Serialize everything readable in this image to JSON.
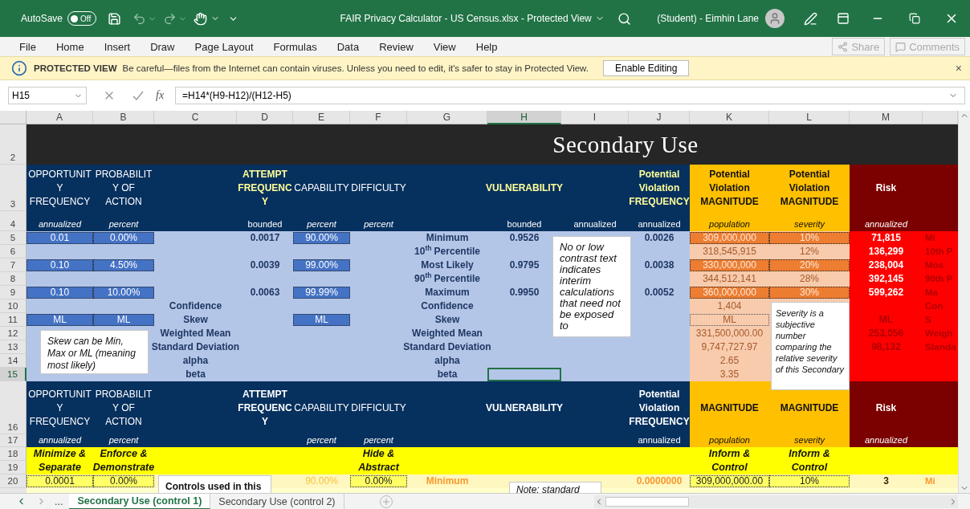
{
  "title_bar": {
    "autosave": {
      "label": "AutoSave",
      "on": false,
      "state_text": "Off"
    },
    "title": "FAIR Privacy Calculator - US Census.xlsx  -  Protected View",
    "user": "(Student) - Eimhin Lane"
  },
  "menu": {
    "items": [
      "File",
      "Home",
      "Insert",
      "Draw",
      "Page Layout",
      "Formulas",
      "Data",
      "Review",
      "View",
      "Help"
    ],
    "actions": [
      {
        "label": "Share",
        "kind": "share",
        "disabled": true
      },
      {
        "label": "Comments",
        "kind": "comments",
        "disabled": true
      }
    ]
  },
  "protected_view": {
    "title": "PROTECTED VIEW",
    "message": "Be careful—files from the Internet can contain viruses. Unless you need to edit, it's safer to stay in Protected View.",
    "button": "Enable Editing",
    "close": "×"
  },
  "formula_bar": {
    "name_box": "H15",
    "function_label": "fx",
    "formula": "=H14*(H9-H12)/(H12-H5)"
  },
  "columns": [
    {
      "label": "A",
      "selected": false
    },
    {
      "label": "B",
      "selected": false
    },
    {
      "label": "C",
      "selected": false
    },
    {
      "label": "D",
      "selected": false
    },
    {
      "label": "E",
      "selected": false
    },
    {
      "label": "F",
      "selected": false
    },
    {
      "label": "G",
      "selected": false
    },
    {
      "label": "H",
      "selected": true
    },
    {
      "label": "I",
      "selected": false
    },
    {
      "label": "J",
      "selected": false
    },
    {
      "label": "K",
      "selected": false
    },
    {
      "label": "L",
      "selected": false
    },
    {
      "label": "M",
      "selected": false
    },
    {
      "selected": false
    }
  ],
  "rows": [
    {
      "label": "2",
      "kind": "title",
      "selected": false,
      "cells": [
        null,
        null,
        null,
        null,
        {
          "kind": "title",
          "text": "Secondary Use"
        },
        null,
        null,
        null,
        null,
        null,
        null,
        null,
        null,
        null
      ]
    },
    {
      "label": "3",
      "kind": "header",
      "selected": false,
      "cells": [
        {
          "kind": "heading",
          "text": "OPPORTUNIT\nY\nFREQUENCY"
        },
        {
          "kind": "heading",
          "text": "PROBABILIT\nY OF\nACTION"
        },
        null,
        {
          "kind": "heading-accent",
          "text": "ATTEMPT\nFREQUENC\nY"
        },
        {
          "kind": "heading",
          "text": "CAPABILITY"
        },
        {
          "kind": "heading",
          "text": "DIFFICULTY"
        },
        null,
        {
          "kind": "heading-accent",
          "text": "VULNERABILITY"
        },
        null,
        {
          "kind": "heading-accent",
          "text": "Potential\nViolation\nFREQUENCY"
        },
        {
          "kind": "heading-strong",
          "text": "Potential\nViolation\nMAGNITUDE"
        },
        {
          "kind": "heading-strong",
          "text": "Potential\nViolation\nMAGNITUDE"
        },
        {
          "kind": "heading-strong",
          "text": "Risk"
        },
        null
      ]
    },
    {
      "label": "4",
      "kind": "units",
      "selected": false,
      "cells": [
        {
          "kind": "unit",
          "italic": true,
          "text": "annualized"
        },
        {
          "kind": "unit",
          "italic": true,
          "text": "percent"
        },
        null,
        {
          "kind": "unit",
          "italic": false,
          "text": "bounded"
        },
        {
          "kind": "unit",
          "italic": true,
          "text": "percent"
        },
        {
          "kind": "unit",
          "italic": true,
          "text": "percent"
        },
        null,
        {
          "kind": "unit",
          "italic": false,
          "text": "bounded"
        },
        {
          "kind": "unit",
          "italic": false,
          "text": "annualized"
        },
        {
          "kind": "unit",
          "italic": false,
          "text": "annualized"
        },
        {
          "kind": "unit",
          "italic": true,
          "text": "population"
        },
        {
          "kind": "unit",
          "italic": true,
          "text": "severity"
        },
        {
          "kind": "unit",
          "italic": true,
          "text": "annualized"
        },
        null
      ]
    },
    {
      "label": "5",
      "kind": "body",
      "selected": false,
      "cells": [
        {
          "kind": "input",
          "text": "0.01"
        },
        {
          "kind": "input",
          "text": "0.00%"
        },
        null,
        {
          "kind": "value",
          "text": "0.0017"
        },
        {
          "kind": "input",
          "text": "90.00%"
        },
        null,
        {
          "kind": "value",
          "text": "Minimum"
        },
        {
          "kind": "value",
          "text": "0.9526"
        },
        null,
        {
          "kind": "value",
          "text": "0.0026"
        },
        {
          "kind": "orange-input",
          "text": "309,000,000"
        },
        {
          "kind": "orange-input",
          "text": "10%"
        },
        {
          "kind": "risk",
          "text": "71,815"
        },
        {
          "kind": "edge",
          "text": "Mi"
        }
      ]
    },
    {
      "label": "6",
      "kind": "body",
      "selected": false,
      "cells": [
        null,
        null,
        null,
        null,
        null,
        null,
        {
          "kind": "value",
          "text": "10$^{th}$ Percentile"
        },
        null,
        null,
        null,
        {
          "kind": "faint",
          "text": "318,545,915"
        },
        {
          "kind": "faint",
          "text": "12%"
        },
        {
          "kind": "risk",
          "text": "136,299"
        },
        {
          "kind": "edge",
          "text": "10th P"
        }
      ]
    },
    {
      "label": "7",
      "kind": "body",
      "selected": false,
      "cells": [
        {
          "kind": "input",
          "text": "0.10"
        },
        {
          "kind": "input",
          "text": "4.50%"
        },
        null,
        {
          "kind": "value",
          "text": "0.0039"
        },
        {
          "kind": "input",
          "text": "99.00%"
        },
        null,
        {
          "kind": "value",
          "text": "Most Likely"
        },
        {
          "kind": "value",
          "text": "0.9795"
        },
        null,
        {
          "kind": "value",
          "text": "0.0038"
        },
        {
          "kind": "orange-input",
          "text": "330,000,000"
        },
        {
          "kind": "orange-input",
          "text": "20%"
        },
        {
          "kind": "risk",
          "text": "238,004"
        },
        {
          "kind": "edge",
          "text": "Mos"
        }
      ]
    },
    {
      "label": "8",
      "kind": "body",
      "selected": false,
      "cells": [
        null,
        null,
        null,
        null,
        null,
        null,
        {
          "kind": "value",
          "text": "90$^{th}$ Percentile"
        },
        null,
        null,
        null,
        {
          "kind": "faint",
          "text": "344,512,141"
        },
        {
          "kind": "faint",
          "text": "28%"
        },
        {
          "kind": "risk",
          "text": "392,145"
        },
        {
          "kind": "edge",
          "text": "90th P"
        }
      ]
    },
    {
      "label": "9",
      "kind": "body",
      "selected": false,
      "cells": [
        {
          "kind": "input",
          "text": "0.10"
        },
        {
          "kind": "input",
          "text": "10.00%"
        },
        null,
        {
          "kind": "value",
          "text": "0.0063"
        },
        {
          "kind": "input",
          "text": "99.99%"
        },
        null,
        {
          "kind": "value",
          "text": "Maximum"
        },
        {
          "kind": "value",
          "text": "0.9950"
        },
        null,
        {
          "kind": "value",
          "text": "0.0052"
        },
        {
          "kind": "orange-input",
          "text": "360,000,000"
        },
        {
          "kind": "orange-input",
          "text": "30%"
        },
        {
          "kind": "risk",
          "text": "599,262"
        },
        {
          "kind": "edge",
          "text": "Ma"
        }
      ]
    },
    {
      "label": "10",
      "kind": "body",
      "selected": false,
      "cells": [
        null,
        null,
        {
          "kind": "value",
          "text": "Confidence"
        },
        null,
        null,
        null,
        {
          "kind": "value",
          "text": "Confidence"
        },
        null,
        null,
        null,
        {
          "kind": "faint",
          "text": "1,404"
        },
        null,
        null,
        {
          "kind": "edge",
          "text": "Con"
        }
      ]
    },
    {
      "label": "11",
      "kind": "body",
      "selected": false,
      "cells": [
        {
          "kind": "input",
          "text": "ML"
        },
        {
          "kind": "input",
          "text": "ML"
        },
        {
          "kind": "value",
          "text": "Skew"
        },
        null,
        {
          "kind": "input",
          "text": "ML"
        },
        null,
        {
          "kind": "value",
          "text": "Skew"
        },
        null,
        null,
        null,
        {
          "kind": "faint-input",
          "text": "ML"
        },
        null,
        {
          "kind": "risk-faint",
          "text": "ML"
        },
        {
          "kind": "edge",
          "text": "S"
        }
      ]
    },
    {
      "label": "12",
      "kind": "body",
      "selected": false,
      "cells": [
        null,
        null,
        {
          "kind": "value",
          "text": "Weighted Mean"
        },
        null,
        null,
        null,
        {
          "kind": "value",
          "text": "Weighted Mean"
        },
        null,
        null,
        null,
        {
          "kind": "faint",
          "text": "331,500,000.00"
        },
        null,
        {
          "kind": "risk-faint",
          "text": "253,056"
        },
        {
          "kind": "edge",
          "text": "Weigh"
        }
      ]
    },
    {
      "label": "13",
      "kind": "body",
      "selected": false,
      "cells": [
        null,
        null,
        {
          "kind": "value",
          "text": "Standard Deviation"
        },
        null,
        null,
        null,
        {
          "kind": "value",
          "text": "Standard Deviation"
        },
        null,
        null,
        null,
        {
          "kind": "faint",
          "text": "9,747,727.97"
        },
        null,
        {
          "kind": "risk-faint",
          "text": "98,132"
        },
        {
          "kind": "edge",
          "text": "Standa"
        }
      ]
    },
    {
      "label": "14",
      "kind": "body",
      "selected": false,
      "cells": [
        null,
        null,
        {
          "kind": "value",
          "text": "alpha"
        },
        null,
        null,
        null,
        {
          "kind": "value",
          "text": "alpha"
        },
        null,
        null,
        null,
        {
          "kind": "faint",
          "text": "2.65"
        },
        null,
        null,
        null
      ]
    },
    {
      "label": "15",
      "kind": "body",
      "selected": true,
      "cells": [
        null,
        null,
        {
          "kind": "value",
          "text": "beta"
        },
        null,
        null,
        null,
        {
          "kind": "value",
          "text": "beta"
        },
        {
          "kind": "active"
        },
        null,
        null,
        {
          "kind": "faint",
          "text": "3.35"
        },
        null,
        null,
        null
      ]
    },
    {
      "label": "16",
      "kind": "header",
      "selected": false,
      "cells": [
        {
          "kind": "heading",
          "text": "OPPORTUNIT\nY\nFREQUENCY"
        },
        {
          "kind": "heading",
          "text": "PROBABILIT\nY OF\nACTION"
        },
        null,
        {
          "kind": "heading-strong",
          "text": "ATTEMPT\nFREQUENC\nY"
        },
        {
          "kind": "heading",
          "text": "CAPABILITY"
        },
        {
          "kind": "heading",
          "text": "DIFFICULTY"
        },
        null,
        {
          "kind": "heading-strong",
          "text": "VULNERABILITY"
        },
        null,
        {
          "kind": "heading-strong",
          "text": "Potential\nViolation\nFREQUENCY"
        },
        {
          "kind": "heading-strong",
          "text": "MAGNITUDE"
        },
        {
          "kind": "heading-strong",
          "text": "MAGNITUDE"
        },
        {
          "kind": "heading-strong",
          "text": "Risk"
        },
        null
      ]
    },
    {
      "label": "17",
      "kind": "units",
      "selected": false,
      "cells": [
        {
          "kind": "unit",
          "italic": true,
          "text": "annualized"
        },
        {
          "kind": "unit",
          "italic": true,
          "text": "percent"
        },
        null,
        null,
        {
          "kind": "unit",
          "italic": true,
          "text": "percent"
        },
        {
          "kind": "unit",
          "italic": true,
          "text": "percent"
        },
        null,
        null,
        null,
        {
          "kind": "unit",
          "italic": false,
          "text": "annualized"
        },
        {
          "kind": "unit",
          "italic": true,
          "text": "population"
        },
        {
          "kind": "unit",
          "italic": true,
          "text": "severity"
        },
        {
          "kind": "unit",
          "italic": true,
          "text": "annualized"
        },
        null
      ]
    },
    {
      "label": "18",
      "kind": "controls",
      "selected": false,
      "cells": [
        {
          "kind": "control-label",
          "merged_down": true,
          "text": "Minimize &\nSeparate"
        },
        {
          "kind": "control-label",
          "merged_down": true,
          "text": "Enforce &\nDemonstrate"
        },
        null,
        null,
        null,
        {
          "kind": "control-label",
          "merged_down": true,
          "text": "Hide &\nAbstract"
        },
        null,
        null,
        null,
        null,
        {
          "kind": "control-label",
          "merged_down": true,
          "text": "Inform &\nControl"
        },
        {
          "kind": "control-label",
          "merged_down": true,
          "text": "Inform &\nControl"
        },
        null,
        null
      ]
    },
    {
      "label": "19",
      "kind": "controls",
      "selected": false,
      "cells": [
        null,
        null,
        null,
        null,
        null,
        null,
        null,
        null,
        null,
        null,
        null,
        null,
        null,
        null
      ]
    },
    {
      "label": "20",
      "kind": "controls-body",
      "selected": false,
      "cells": [
        {
          "kind": "control-input",
          "text": "0.0001"
        },
        {
          "kind": "control-input",
          "text": "0.00%"
        },
        null,
        null,
        {
          "kind": "control-faint",
          "text": "90.00%"
        },
        {
          "kind": "control-input",
          "text": "0.00%"
        },
        {
          "kind": "control-calc",
          "text": "Minimum"
        },
        null,
        null,
        {
          "kind": "control-calc",
          "text": "0.0000000"
        },
        {
          "kind": "control-input",
          "text": "309,000,000.00"
        },
        {
          "kind": "control-input",
          "text": "10%"
        },
        {
          "kind": "control-risk",
          "text": "3"
        },
        {
          "kind": "control-edge",
          "text": "Mi"
        }
      ]
    }
  ],
  "notes": [
    {
      "kind": "note",
      "text": "Skew can be Min, Max or ML (meaning most likely)"
    },
    {
      "kind": "note",
      "text": "No or low contrast text indicates interim calculations that need not be exposed to"
    },
    {
      "kind": "note",
      "text": "Severity is a subjective number comparing the relative severity of this Secondary"
    },
    {
      "kind": "note-bold",
      "text": "Controls used in this"
    },
    {
      "kind": "note",
      "text": "Note: standard"
    }
  ],
  "sheet_tabs": {
    "more": "...",
    "tabs": [
      {
        "label": "Secondary Use (control 1)",
        "selected": true
      },
      {
        "label": "Secondary Use (control 2)",
        "selected": false
      }
    ]
  }
}
